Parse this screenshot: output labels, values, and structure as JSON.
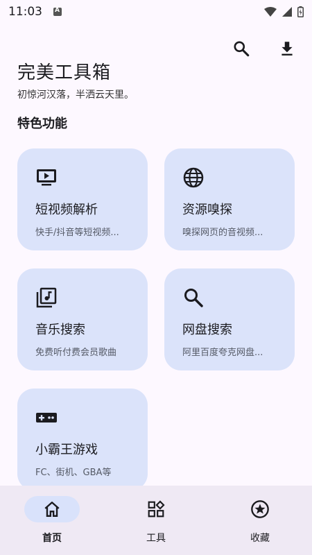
{
  "status_bar": {
    "time": "11:03"
  },
  "header": {
    "title": "完美工具箱",
    "subtitle": "初惊河汉落，半洒云天里。"
  },
  "actions": {
    "search_icon": "search-icon",
    "download_icon": "download-icon"
  },
  "section": {
    "title": "特色功能"
  },
  "cards": [
    {
      "icon": "tv-play-icon",
      "title": "短视频解析",
      "desc": "快手/抖音等短视频..."
    },
    {
      "icon": "globe-icon",
      "title": "资源嗅探",
      "desc": "嗅探网页的音视频..."
    },
    {
      "icon": "music-library-icon",
      "title": "音乐搜索",
      "desc": "免费听付费会员歌曲"
    },
    {
      "icon": "search-icon",
      "title": "网盘搜索",
      "desc": "阿里百度夸克网盘..."
    },
    {
      "icon": "gamepad-icon",
      "title": "小霸王游戏",
      "desc": "FC、街机、GBA等"
    }
  ],
  "bottom_nav": [
    {
      "icon": "home-icon",
      "label": "首页",
      "active": true
    },
    {
      "icon": "widgets-icon",
      "label": "工具",
      "active": false
    },
    {
      "icon": "star-badge-icon",
      "label": "收藏",
      "active": false
    }
  ],
  "colors": {
    "background": "#fdf8ff",
    "card": "#dbe3fa",
    "nav_bg": "#efe9f4",
    "nav_active": "#d9e2fb",
    "text": "#1b1b1f"
  }
}
